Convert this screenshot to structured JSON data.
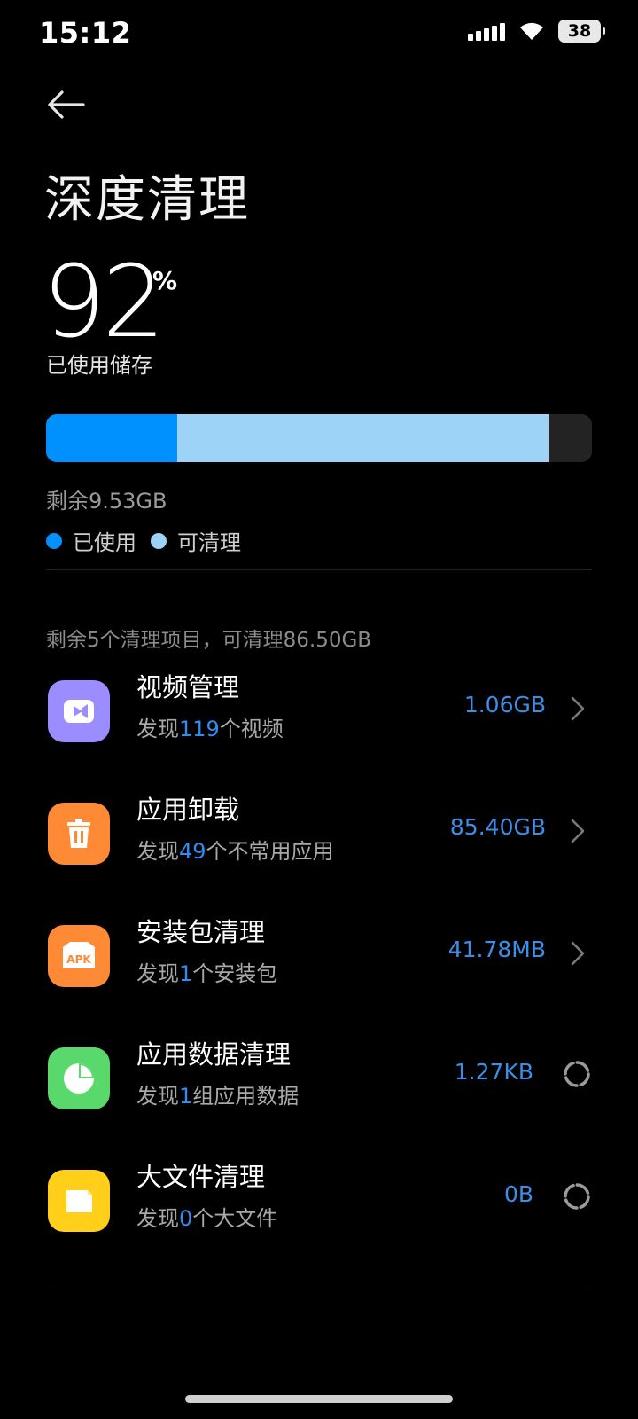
{
  "status_bar": {
    "time": "15:12",
    "battery": "38"
  },
  "header": {
    "title": "深度清理"
  },
  "usage": {
    "percent": "92",
    "unit": "%",
    "label": "已使用储存",
    "used_fraction": 0.24,
    "cleanable_fraction": 0.68,
    "remaining": "剩余9.53GB"
  },
  "legend": {
    "used": "已使用",
    "cleanable": "可清理"
  },
  "colors": {
    "used": "#0091ff",
    "cleanable": "#9dd3f7",
    "accent": "#3b8fe8"
  },
  "summary": "剩余5个清理项目，可清理86.50GB",
  "items": [
    {
      "title": "视频管理",
      "sub_prefix": "发现",
      "sub_count": "119",
      "sub_suffix": "个视频",
      "size": "1.06GB",
      "icon": "video-icon",
      "status": "chevron"
    },
    {
      "title": "应用卸载",
      "sub_prefix": "发现",
      "sub_count": "49",
      "sub_suffix": "个不常用应用",
      "size": "85.40GB",
      "icon": "trash-icon",
      "status": "chevron"
    },
    {
      "title": "安装包清理",
      "sub_prefix": "发现",
      "sub_count": "1",
      "sub_suffix": "个安装包",
      "size": "41.78MB",
      "icon": "apk-icon",
      "icon_text": "APK",
      "status": "chevron"
    },
    {
      "title": "应用数据清理",
      "sub_prefix": "发现",
      "sub_count": "1",
      "sub_suffix": "组应用数据",
      "size": "1.27KB",
      "icon": "pie-chart-icon",
      "status": "loading"
    },
    {
      "title": "大文件清理",
      "sub_prefix": "发现",
      "sub_count": "0",
      "sub_suffix": "个大文件",
      "size": "0B",
      "icon": "folder-icon",
      "status": "loading"
    }
  ]
}
